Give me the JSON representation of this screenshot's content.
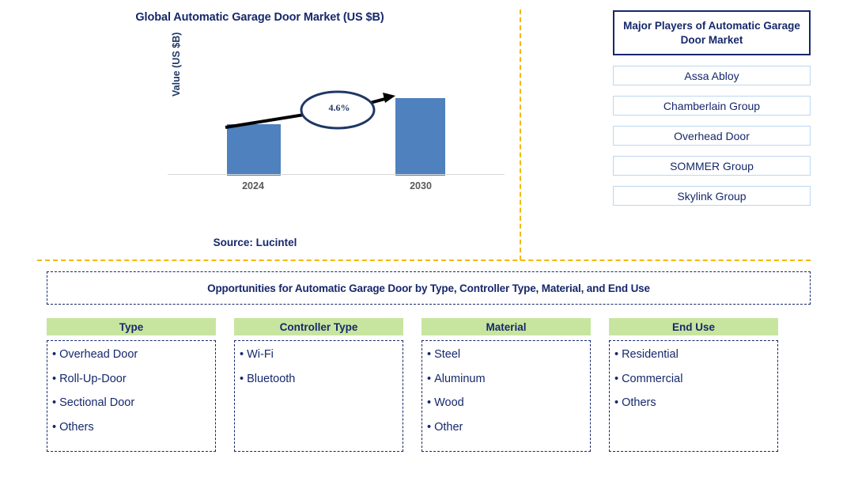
{
  "chart": {
    "title": "Global Automatic Garage Door Market (US $B)",
    "y_axis_label": "Value (US $B)",
    "source": "Source: Lucintel",
    "cagr_label": "4.6%"
  },
  "chart_data": {
    "type": "bar",
    "title": "Global Automatic Garage Door Market (US $B)",
    "xlabel": "",
    "ylabel": "Value (US $B)",
    "categories": [
      "2024",
      "2030"
    ],
    "values": [
      65,
      98
    ],
    "value_units": "relative bar height (px); absolute values not labeled",
    "annotations": [
      {
        "text": "4.6%",
        "type": "cagr-callout",
        "from": "2024",
        "to": "2030"
      }
    ],
    "grid": false,
    "legend": "none",
    "ylim": [
      0,
      110
    ],
    "source": "Source: Lucintel"
  },
  "players": {
    "header": "Major Players of Automatic Garage Door Market",
    "items": [
      "Assa Abloy",
      "Chamberlain Group",
      "Overhead Door",
      "SOMMER Group",
      "Skylink Group"
    ]
  },
  "opportunities": {
    "title": "Opportunities for Automatic Garage Door by Type, Controller Type, Material, and End Use",
    "columns": [
      {
        "header": "Type",
        "items": [
          "Overhead Door",
          "Roll-Up-Door",
          "Sectional Door",
          "Others"
        ]
      },
      {
        "header": "Controller Type",
        "items": [
          "Wi-Fi",
          "Bluetooth"
        ]
      },
      {
        "header": "Material",
        "items": [
          "Steel",
          "Aluminum",
          "Wood",
          "Other"
        ]
      },
      {
        "header": "End Use",
        "items": [
          "Residential",
          "Commercial",
          "Others"
        ]
      }
    ]
  },
  "colors": {
    "bar": "#4E81BD",
    "navy": "#16286B",
    "divider_orange": "#F5B800",
    "header_green": "#C8E5A0",
    "player_border": "#BDD7EE"
  },
  "bullet": "•"
}
